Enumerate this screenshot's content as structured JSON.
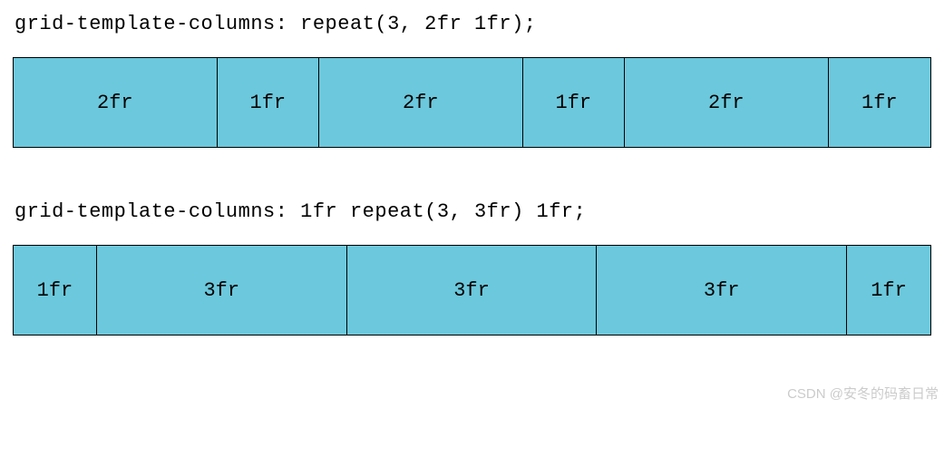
{
  "example1": {
    "code": "grid-template-columns: repeat(3, 2fr 1fr);",
    "columns": [
      "2fr",
      "1fr",
      "2fr",
      "1fr",
      "2fr",
      "1fr"
    ]
  },
  "example2": {
    "code": "grid-template-columns: 1fr repeat(3, 3fr) 1fr;",
    "columns": [
      "1fr",
      "3fr",
      "3fr",
      "3fr",
      "1fr"
    ]
  },
  "watermark": "CSDN @安冬的码畜日常"
}
